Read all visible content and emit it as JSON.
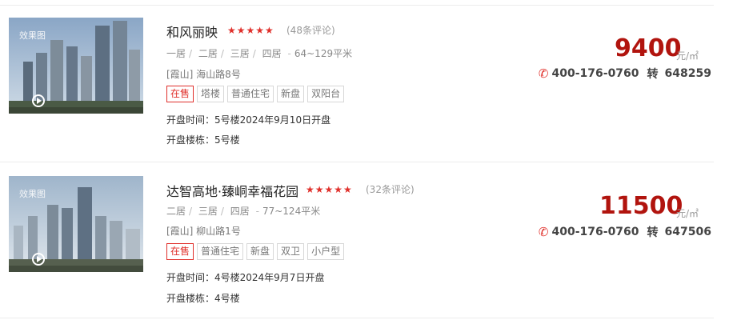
{
  "listings": [
    {
      "thumbnail_label": "效果图",
      "name": "和风丽映",
      "stars": "★★★★★",
      "reviews": "(48条评论)",
      "rooms": [
        "一居",
        "二居",
        "三居",
        "四居"
      ],
      "area": "64~129平米",
      "address": "[霞山] 海山路8号",
      "tags": [
        "在售",
        "塔楼",
        "普通住宅",
        "新盘",
        "双阳台"
      ],
      "open_time": "开盘时间：5号楼2024年9月10日开盘",
      "open_building": "开盘楼栋：5号楼",
      "price": "9400",
      "price_unit": "元/㎡",
      "phone": "400-176-0760",
      "ext_prefix": "转",
      "ext": "648259"
    },
    {
      "thumbnail_label": "效果图",
      "name": "达智高地·臻峒幸福花园",
      "stars": "★★★★★",
      "reviews": "(32条评论)",
      "rooms": [
        "二居",
        "三居",
        "四居"
      ],
      "area": "77~124平米",
      "address": "[霞山] 柳山路1号",
      "tags": [
        "在售",
        "普通住宅",
        "新盘",
        "双卫",
        "小户型"
      ],
      "open_time": "开盘时间：4号楼2024年9月7日开盘",
      "open_building": "开盘楼栋：4号楼",
      "price": "11500",
      "price_unit": "元/㎡",
      "phone": "400-176-0760",
      "ext_prefix": "转",
      "ext": "647506"
    }
  ],
  "colors": {
    "price": "#b1140e",
    "accent": "#e0302b",
    "text": "#333333",
    "muted": "#999999"
  },
  "icons": {
    "play": "play-circle-icon",
    "phone": "phone-icon",
    "star": "star-icon"
  }
}
